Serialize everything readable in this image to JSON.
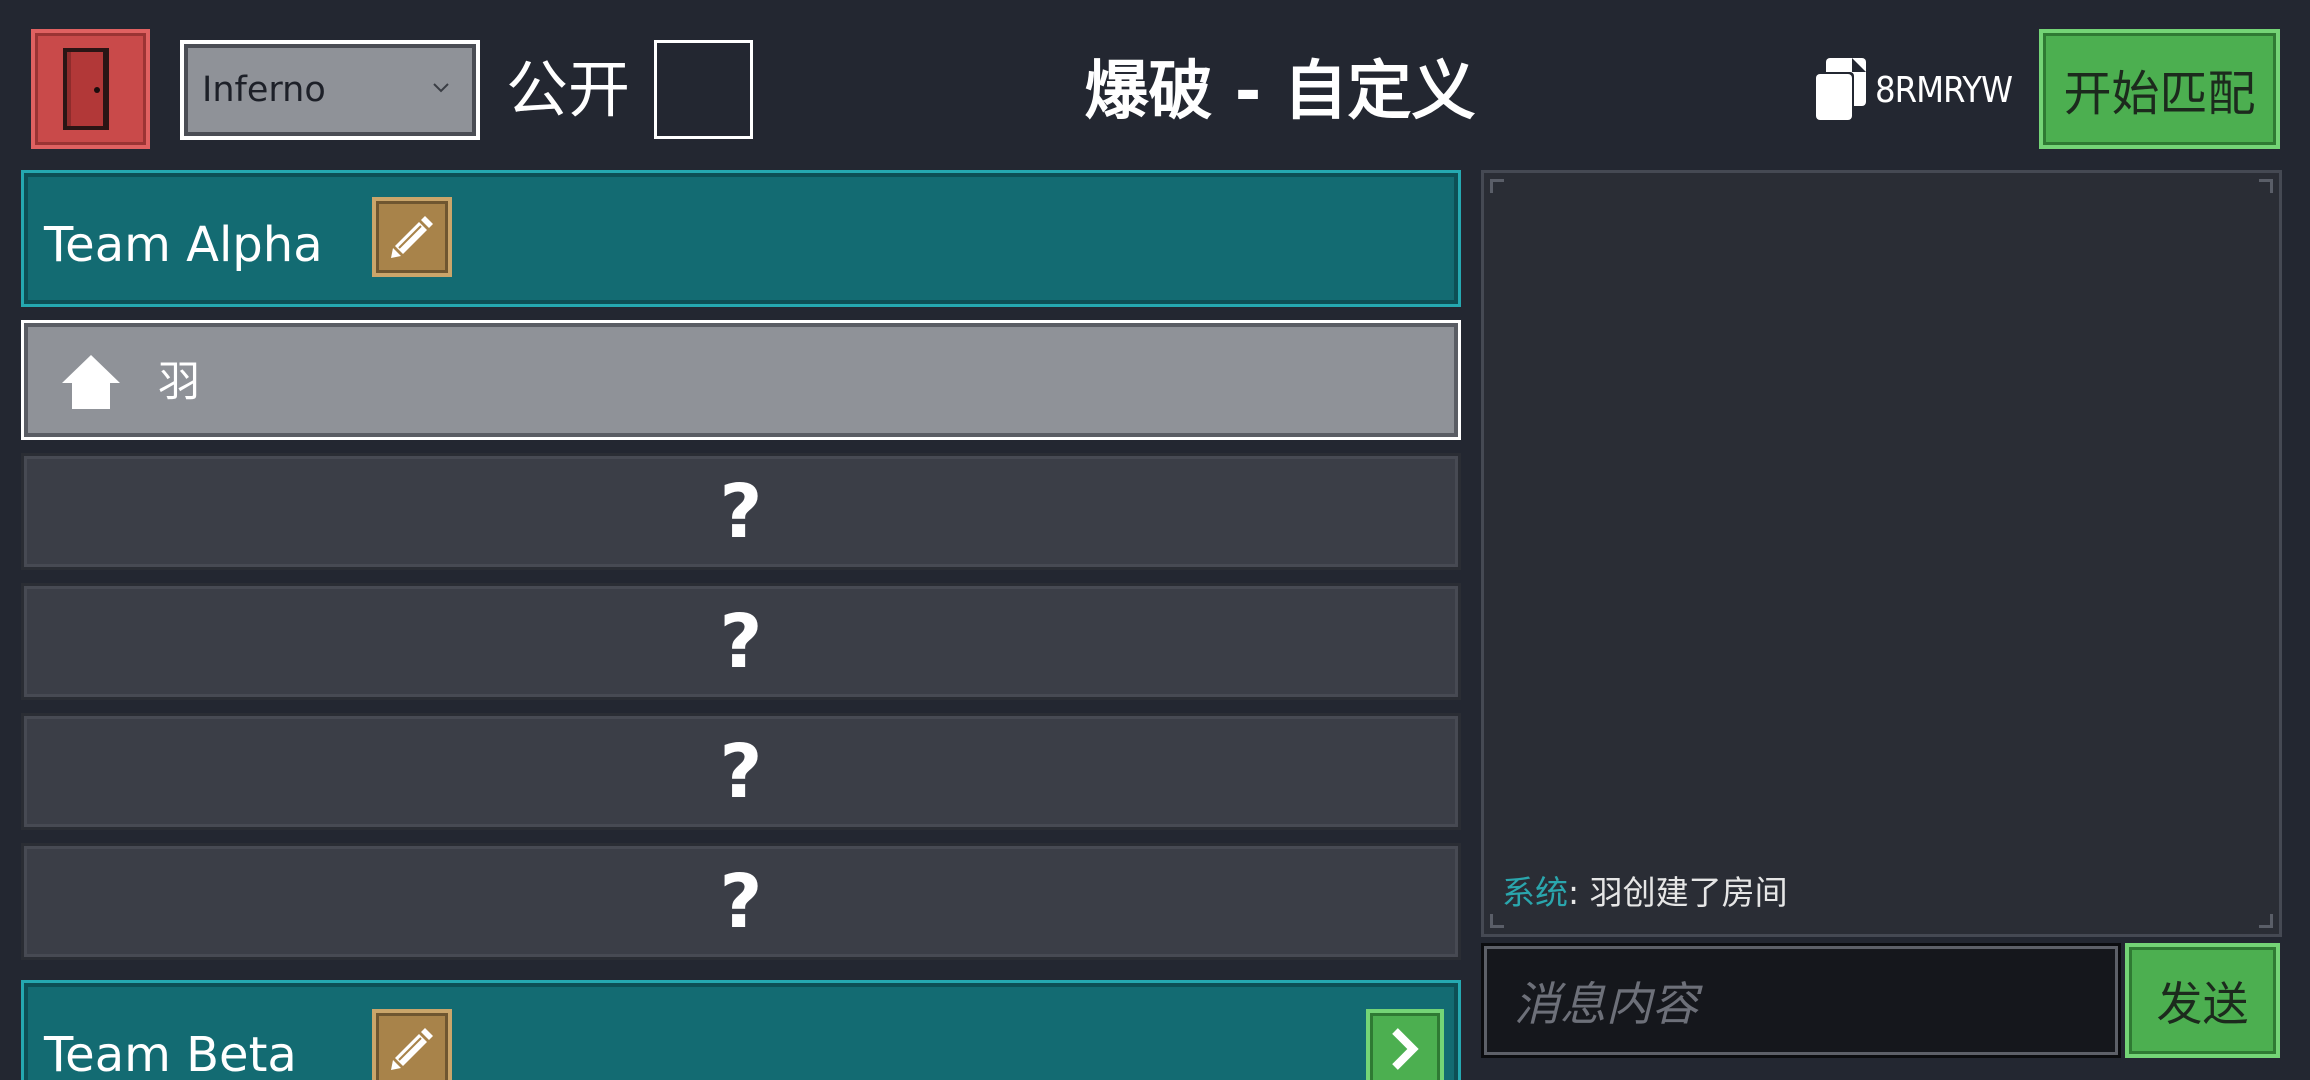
{
  "header": {
    "map_select_value": "Inferno",
    "public_label": "公开",
    "title": "爆破 - 自定义",
    "room_code": "8RMRYW",
    "start_button": "开始匹配"
  },
  "teams": [
    {
      "name": "Team Alpha",
      "players": [
        {
          "name": "羽",
          "is_host": true
        }
      ],
      "empty_slots": [
        "?",
        "?",
        "?",
        "?"
      ]
    },
    {
      "name": "Team Beta"
    }
  ],
  "chat": {
    "messages": [
      {
        "sender": "系统",
        "separator": ": ",
        "text": "羽创建了房间"
      }
    ],
    "input_placeholder": "消息内容",
    "send_button": "发送"
  },
  "colors": {
    "background": "#232731",
    "team_header": "#136b72",
    "team_header_border": "#25a8b0",
    "accent_green": "#4caf50",
    "exit_red": "#c94a4a",
    "edit_gold": "#a8834a",
    "system_text": "#2aa6ad"
  },
  "icons": {
    "exit": "door-exit-icon",
    "select": "chevron-down-icon",
    "copy": "copy-icon",
    "edit": "pencil-icon",
    "host": "house-icon",
    "next": "chevron-right-icon"
  }
}
